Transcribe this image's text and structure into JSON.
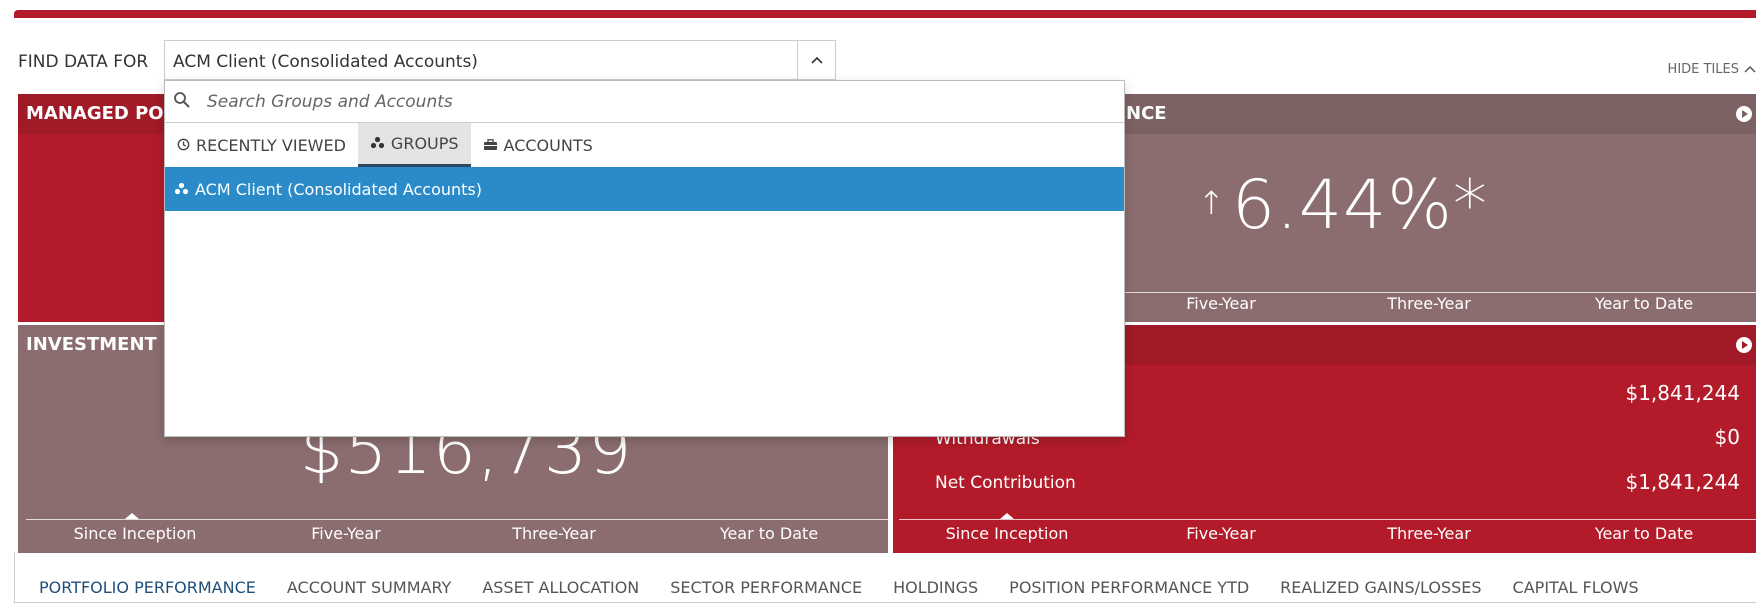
{
  "find_data": {
    "label": "FIND DATA FOR",
    "selected": "ACM Client (Consolidated Accounts)"
  },
  "hide_tiles_label": "HIDE TILES",
  "tiles": {
    "managed_portfolios": {
      "title": "MANAGED PO"
    },
    "performance": {
      "title": "NCE",
      "value": "6.44%*",
      "periods": [
        "Five-Year",
        "Three-Year",
        "Year to Date"
      ]
    },
    "investment": {
      "title": "INVESTMENT C",
      "value": "$516,739",
      "periods": [
        "Since Inception",
        "Five-Year",
        "Three-Year",
        "Year to Date"
      ]
    },
    "capital_flows": {
      "rows": [
        {
          "label": "",
          "value": "$1,841,244"
        },
        {
          "label": "Withdrawals",
          "value": "$0"
        },
        {
          "label": "Net Contribution",
          "value": "$1,841,244"
        }
      ],
      "periods": [
        "Since Inception",
        "Five-Year",
        "Three-Year",
        "Year to Date"
      ]
    }
  },
  "dropdown": {
    "search_placeholder": "Search Groups and Accounts",
    "tabs": [
      {
        "label": "RECENTLY VIEWED",
        "icon": "clock-icon"
      },
      {
        "label": "GROUPS",
        "icon": "group-icon"
      },
      {
        "label": "ACCOUNTS",
        "icon": "briefcase-icon"
      }
    ],
    "items": [
      {
        "label": "ACM Client (Consolidated Accounts)",
        "icon": "group-icon"
      }
    ]
  },
  "bottom_nav": [
    "PORTFOLIO PERFORMANCE",
    "ACCOUNT SUMMARY",
    "ASSET ALLOCATION",
    "SECTOR PERFORMANCE",
    "HOLDINGS",
    "POSITION PERFORMANCE YTD",
    "REALIZED GAINS/LOSSES",
    "CAPITAL FLOWS"
  ],
  "colors": {
    "brand_red": "#b31b2a",
    "tile_taupe": "#8b6d6f",
    "selection_blue": "#2b8bc9",
    "active_nav": "#1f4f7a"
  }
}
